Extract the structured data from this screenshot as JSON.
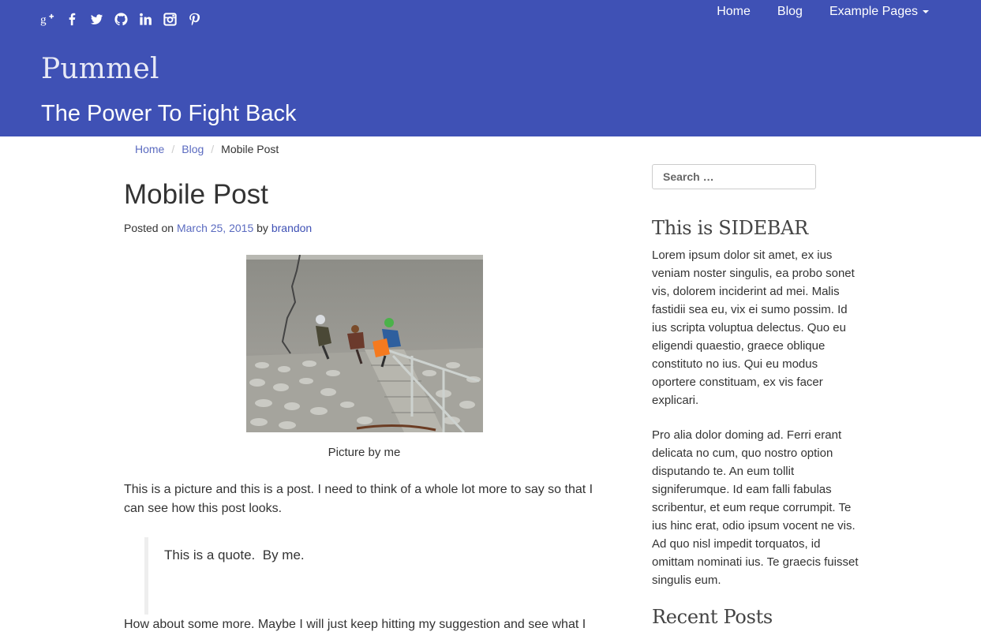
{
  "header": {
    "social_icons": [
      "google-plus-icon",
      "facebook-icon",
      "twitter-icon",
      "github-icon",
      "linkedin-icon",
      "instagram-icon",
      "pinterest-icon"
    ],
    "nav": {
      "home": "Home",
      "blog": "Blog",
      "example_pages": "Example Pages"
    },
    "site_title": "Pummel",
    "tagline": "The Power To Fight Back",
    "bg_color": "#3f51b5"
  },
  "breadcrumb": {
    "home": "Home",
    "sep": "/",
    "blog": "Blog",
    "current": "Mobile Post"
  },
  "post": {
    "title": "Mobile Post",
    "posted_on": "Posted on",
    "date": "March 25, 2015",
    "by": "by",
    "author": "brandon",
    "image_caption": "Picture by me",
    "paragraph1": "This is a picture and this is a post. I need to think of a whole lot more to say so that I can see how this post looks.",
    "quote": "This is a quote.  By me.",
    "paragraph2": "How about some more. Maybe I will just keep hitting my suggestion and see what I"
  },
  "sidebar": {
    "search_placeholder": "Search …",
    "widget_title": "This is SIDEBAR",
    "text1": "Lorem ipsum dolor sit amet, ex ius veniam noster singulis, ea probo sonet vis, dolorem inciderint ad mei. Malis fastidii sea eu, vix ei sumo possim. Id ius scripta voluptua delectus. Quo eu eligendi quaestio, graece oblique constituto no ius. Qui eu modus oportere constituam, ex vis facer explicari.",
    "text2": "Pro alia dolor doming ad. Ferri erant delicata no cum, quo nostro option disputando te. An eum tollit signiferumque. Id eam falli fabulas scribentur, et eum reque corrumpit. Te ius hinc erat, odio ipsum vocent ne vis. Ad quo nisl impedit torquatos, id omittam nominati ius. Te graecis fuisset singulis eum.",
    "recent_title": "Recent Posts"
  }
}
